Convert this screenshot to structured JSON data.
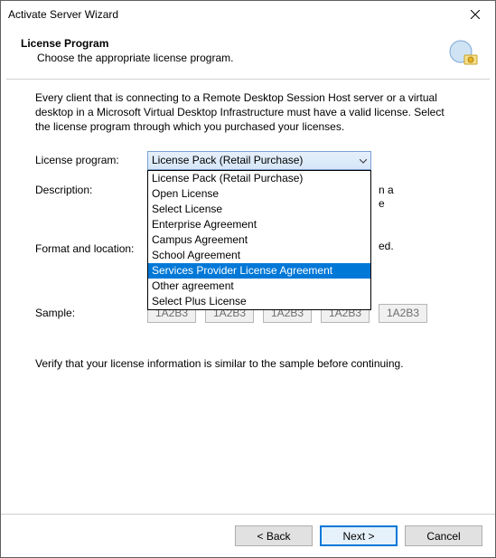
{
  "window": {
    "title": "Activate Server Wizard"
  },
  "header": {
    "heading": "License Program",
    "sub": "Choose the appropriate license program."
  },
  "intro": "Every client that is connecting to a Remote Desktop Session Host server or a virtual desktop in a Microsoft Virtual Desktop Infrastructure must have a valid license. Select the license program through which you purchased your licenses.",
  "labels": {
    "program": "License program:",
    "description": "Description:",
    "format": "Format and location:",
    "sample": "Sample:"
  },
  "select": {
    "current": "License Pack (Retail Purchase)",
    "options": [
      "License Pack (Retail Purchase)",
      "Open License",
      "Select License",
      "Enterprise Agreement",
      "Campus Agreement",
      "School Agreement",
      "Services Provider License Agreement",
      "Other agreement",
      "Select Plus License"
    ],
    "highlighted_index": 6
  },
  "desc_frag_right1": "n a",
  "desc_frag_right2": "e",
  "format_frag_right": "ed.",
  "sample_values": [
    "1A2B3",
    "1A2B3",
    "1A2B3",
    "1A2B3",
    "1A2B3"
  ],
  "verify": "Verify that your license information is similar to the sample before continuing.",
  "buttons": {
    "back": "< Back",
    "next": "Next >",
    "cancel": "Cancel"
  }
}
